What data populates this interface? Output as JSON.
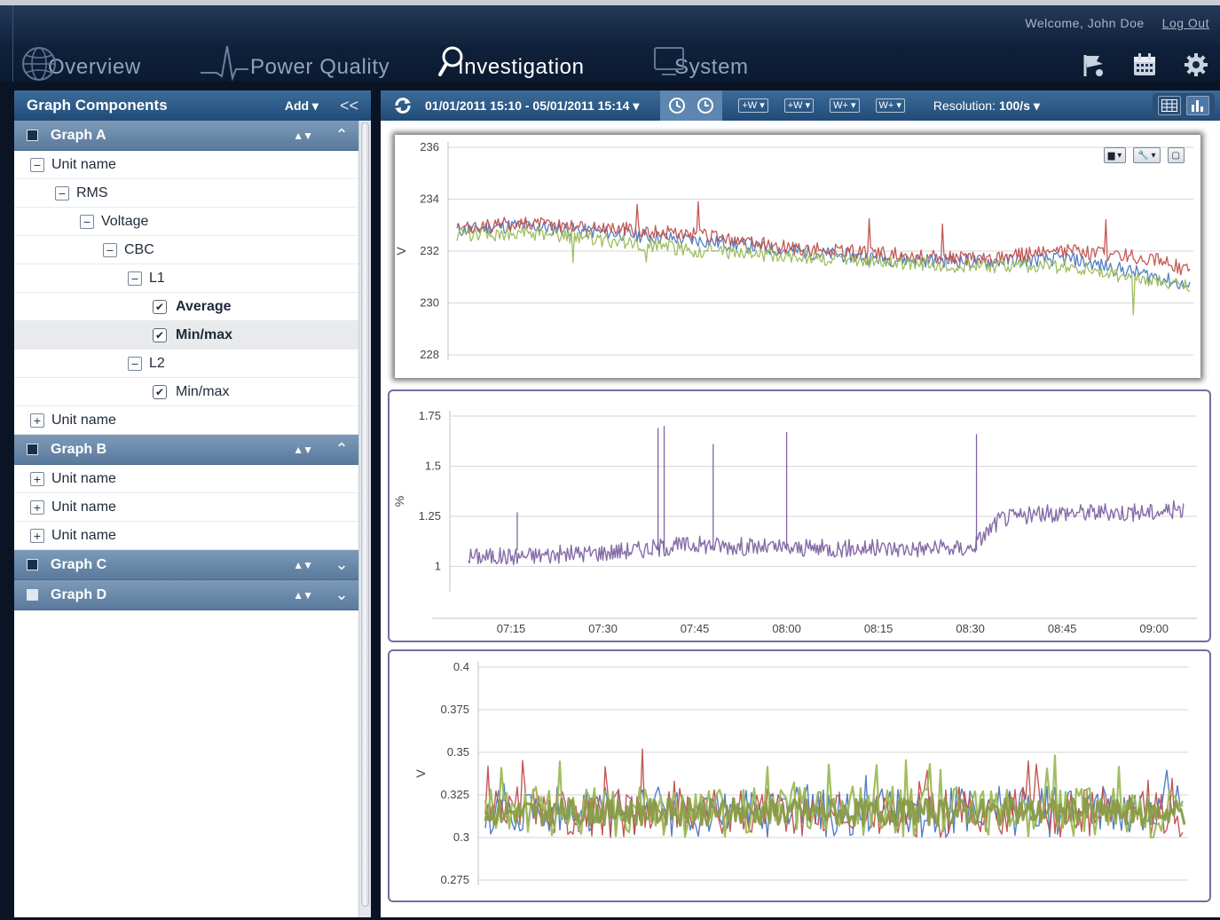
{
  "header": {
    "welcome": "Welcome, John Doe",
    "logout": "Log Out",
    "tabs": [
      {
        "label": "Overview",
        "icon": "globe-icon",
        "active": false
      },
      {
        "label": "Power Quality",
        "icon": "waveform-icon",
        "active": false
      },
      {
        "label": "Investigation",
        "icon": "magnifier-icon",
        "active": true
      },
      {
        "label": "System",
        "icon": "monitor-icon",
        "active": false
      }
    ],
    "icons": [
      "flag-icon",
      "calendar-icon",
      "gear-icon"
    ]
  },
  "sidebar": {
    "title": "Graph Components",
    "add": "Add ▾",
    "collapse": "<<",
    "graphs": [
      {
        "name": "Graph A",
        "sort": "▲▼",
        "fold": "⌃"
      },
      {
        "name": "Graph B",
        "sort": "▲▼",
        "fold": "⌃"
      },
      {
        "name": "Graph C",
        "sort": "▲▼",
        "fold": "⌄"
      },
      {
        "name": "Graph D",
        "sort": "▲▼",
        "fold": "⌄"
      }
    ],
    "graphA": {
      "unit": "Unit name",
      "rms": "RMS",
      "voltage": "Voltage",
      "cbc": "CBC",
      "l1": "L1",
      "average": "Average",
      "minmax1": "Min/max",
      "l2": "L2",
      "minmax2": "Min/max",
      "unit2": "Unit name"
    },
    "graphB": {
      "units": [
        "Unit name",
        "Unit name",
        "Unit name"
      ]
    }
  },
  "toolbar": {
    "date_range": "01/01/2011 15:10 -  05/01/2011 15:14  ▾",
    "resolution_label": "Resolution:",
    "resolution_value": "100/s ▾",
    "wave_buttons": [
      "+W ▾",
      "+W ▾",
      "W+ ▾",
      "W+ ▾"
    ]
  },
  "colors": {
    "blue": "#4a78c0",
    "red": "#c0504d",
    "green": "#9bbb59",
    "purple": "#8064a2",
    "accent": "#2a5482"
  },
  "chart_data": [
    {
      "type": "line",
      "ylabel": "V",
      "ylim": [
        228,
        236
      ],
      "yticks": [
        "236",
        "234",
        "232",
        "230",
        "228"
      ],
      "series": [],
      "x_range": [
        "07:05",
        "09:05"
      ],
      "trend": {
        "x": [
          "07:05",
          "07:15",
          "07:30",
          "07:45",
          "08:00",
          "08:15",
          "08:30",
          "08:45",
          "09:00",
          "09:05"
        ],
        "red": [
          232.8,
          233.1,
          232.9,
          232.6,
          232.1,
          231.9,
          231.7,
          232.0,
          231.7,
          231.2
        ],
        "blue": [
          232.8,
          233.0,
          232.7,
          232.4,
          232.0,
          231.7,
          231.6,
          231.7,
          231.0,
          230.6
        ],
        "green": [
          232.6,
          232.7,
          232.4,
          232.0,
          231.8,
          231.6,
          231.4,
          231.4,
          230.8,
          230.6
        ]
      }
    },
    {
      "type": "line",
      "ylabel": "%",
      "ylim": [
        0.9,
        1.75
      ],
      "yticks": [
        "1.75",
        "1.5",
        "1.25",
        "1"
      ],
      "xticks": [
        "07:15",
        "07:30",
        "07:45",
        "08:00",
        "08:15",
        "08:30",
        "08:45",
        "09:00"
      ],
      "series": [],
      "trend": {
        "x": [
          "07:05",
          "07:15",
          "07:30",
          "07:45",
          "08:00",
          "08:15",
          "08:30",
          "08:35",
          "08:45",
          "09:00",
          "09:05"
        ],
        "purple": [
          1.05,
          1.05,
          1.07,
          1.11,
          1.09,
          1.09,
          1.09,
          1.24,
          1.27,
          1.27,
          1.29
        ]
      }
    },
    {
      "type": "line",
      "ylabel": "V",
      "ylim": [
        0.275,
        0.4
      ],
      "yticks": [
        "0.4",
        "0.375",
        "0.35",
        "0.325",
        "0.3",
        "0.275"
      ],
      "series": [],
      "trend": {
        "mean": 0.315
      }
    }
  ]
}
